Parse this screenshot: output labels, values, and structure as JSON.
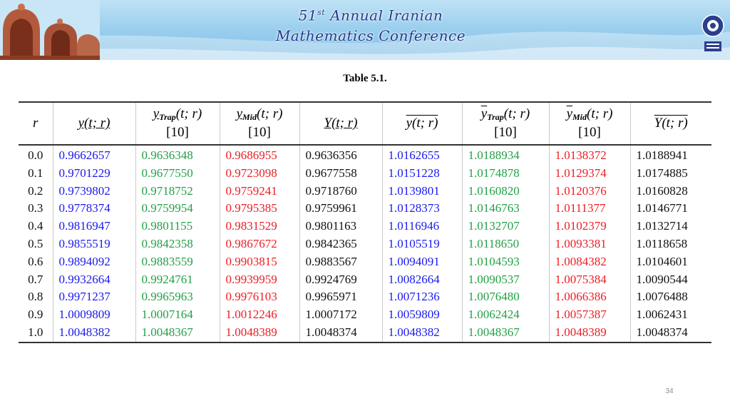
{
  "banner": {
    "title_line1_ordinal": "51",
    "title_line1_suffix": "st",
    "title_line1_rest": "Annual Iranian",
    "title_line2": "Mathematics Conference"
  },
  "caption": "Table 5.1.",
  "table": {
    "headers": [
      {
        "main": "r",
        "sub": ""
      },
      {
        "main": "y(t; r)",
        "sub": ""
      },
      {
        "main": "y",
        "index": "Trap",
        "rest": "(t; r)",
        "sub": "[10]"
      },
      {
        "main": "y",
        "index": "Mid",
        "rest": "(t; r)",
        "sub": "[10]"
      },
      {
        "main": "Y(t; r)",
        "sub": ""
      },
      {
        "main": "y(t; r)",
        "sub": ""
      },
      {
        "main": "y",
        "index": "Trap",
        "rest": "(t; r)",
        "sub": "[10]"
      },
      {
        "main": "y",
        "index": "Mid",
        "rest": "(t; r)",
        "sub": "[10]"
      },
      {
        "main": "Y(t; r)",
        "sub": ""
      }
    ],
    "column_colors": [
      "#111111",
      "#1a1aee",
      "#23a046",
      "#ee1d24",
      "#111111",
      "#1a1aee",
      "#23a046",
      "#ee1d24",
      "#111111"
    ],
    "rows": [
      [
        "0.0",
        "0.9662657",
        "0.9636348",
        "0.9686955",
        "0.9636356",
        "1.0162655",
        "1.0188934",
        "1.0138372",
        "1.0188941"
      ],
      [
        "0.1",
        "0.9701229",
        "0.9677550",
        "0.9723098",
        "0.9677558",
        "1.0151228",
        "1.0174878",
        "1.0129374",
        "1.0174885"
      ],
      [
        "0.2",
        "0.9739802",
        "0.9718752",
        "0.9759241",
        "0.9718760",
        "1.0139801",
        "1.0160820",
        "1.0120376",
        "1.0160828"
      ],
      [
        "0.3",
        "0.9778374",
        "0.9759954",
        "0.9795385",
        "0.9759961",
        "1.0128373",
        "1.0146763",
        "1.0111377",
        "1.0146771"
      ],
      [
        "0.4",
        "0.9816947",
        "0.9801155",
        "0.9831529",
        "0.9801163",
        "1.0116946",
        "1.0132707",
        "1.0102379",
        "1.0132714"
      ],
      [
        "0.5",
        "0.9855519",
        "0.9842358",
        "0.9867672",
        "0.9842365",
        "1.0105519",
        "1.0118650",
        "1.0093381",
        "1.0118658"
      ],
      [
        "0.6",
        "0.9894092",
        "0.9883559",
        "0.9903815",
        "0.9883567",
        "1.0094091",
        "1.0104593",
        "1.0084382",
        "1.0104601"
      ],
      [
        "0.7",
        "0.9932664",
        "0.9924761",
        "0.9939959",
        "0.9924769",
        "1.0082664",
        "1.0090537",
        "1.0075384",
        "1.0090544"
      ],
      [
        "0.8",
        "0.9971237",
        "0.9965963",
        "0.9976103",
        "0.9965971",
        "1.0071236",
        "1.0076480",
        "1.0066386",
        "1.0076488"
      ],
      [
        "0.9",
        "1.0009809",
        "1.0007164",
        "1.0012246",
        "1.0007172",
        "1.0059809",
        "1.0062424",
        "1.0057387",
        "1.0062431"
      ],
      [
        "1.0",
        "1.0048382",
        "1.0048367",
        "1.0048389",
        "1.0048374",
        "1.0048382",
        "1.0048367",
        "1.0048389",
        "1.0048374"
      ]
    ]
  },
  "page_number": "34"
}
